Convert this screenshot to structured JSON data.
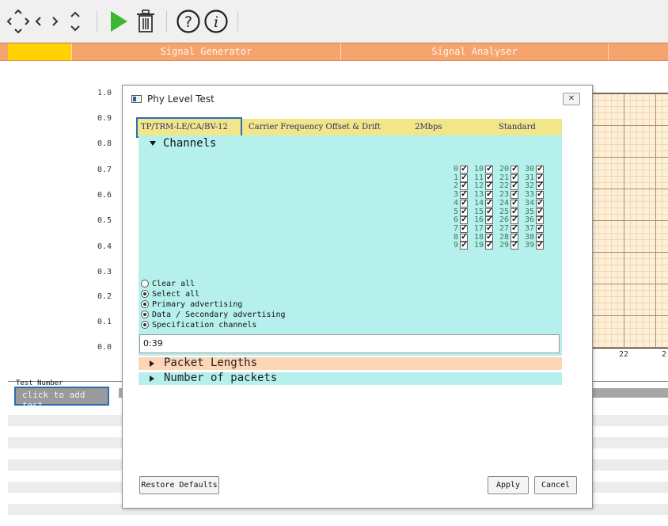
{
  "toolbar": {
    "icons": [
      "expand-icon",
      "shrink-icon",
      "collapse-icon",
      "play-icon",
      "trash-icon",
      "help-icon",
      "info-icon"
    ],
    "play_color": "#3cb830"
  },
  "header": {
    "signal_generator": "Signal Generator",
    "signal_analyser": "Signal Analyser"
  },
  "chart": {
    "y_ticks": [
      "1.0",
      "0.9",
      "0.8",
      "0.7",
      "0.6",
      "0.5",
      "0.4",
      "0.3",
      "0.2",
      "0.1",
      "0.0"
    ],
    "x_ticks": [
      "22",
      "2"
    ]
  },
  "test_list": {
    "header": "Test Number",
    "add_label": "click to add test"
  },
  "dialog": {
    "title": "Phy Level Test",
    "close_label": "✕",
    "tabs": {
      "test_id": "TP/TRM-LE/CA/BV-12",
      "test_name": "Carrier Frequency Offset & Drift",
      "phy": "2Mbps",
      "mode": "Standard"
    },
    "channels_title": "Channels",
    "channels": [
      [
        0,
        1,
        2,
        3,
        4,
        5,
        6,
        7,
        8,
        9
      ],
      [
        10,
        11,
        12,
        13,
        14,
        15,
        16,
        17,
        18,
        19
      ],
      [
        20,
        21,
        22,
        23,
        24,
        25,
        26,
        27,
        28,
        29
      ],
      [
        30,
        31,
        32,
        33,
        34,
        35,
        36,
        37,
        38,
        39
      ]
    ],
    "radios": [
      {
        "label": "Clear all",
        "selected": false
      },
      {
        "label": "Select all",
        "selected": true
      },
      {
        "label": "Primary advertising",
        "selected": true
      },
      {
        "label": "Data / Secondary advertising",
        "selected": true
      },
      {
        "label": "Specification channels",
        "selected": true
      }
    ],
    "range_value": "0:39",
    "packet_lengths": "Packet Lengths",
    "number_of_packets": "Number of packets",
    "restore_defaults": "Restore Defaults",
    "apply": "Apply",
    "cancel": "Cancel",
    "colors": {
      "channels_bg": "#b6f0ec",
      "packet_lengths_bg": "#fcd6b6",
      "tab_bg": "#f1e68a",
      "selection_border": "#2a6db8"
    }
  }
}
